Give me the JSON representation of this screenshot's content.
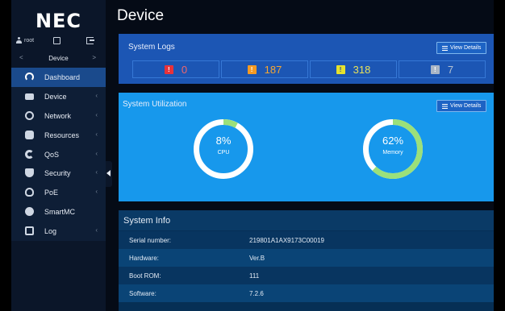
{
  "brand": "NEC",
  "user": {
    "name": "root"
  },
  "breadcrumb": {
    "prev": "<",
    "current": "Device",
    "next": ">"
  },
  "menu": [
    {
      "label": "Dashboard",
      "icon": "dashboard-icon",
      "active": true
    },
    {
      "label": "Device",
      "icon": "device-icon"
    },
    {
      "label": "Network",
      "icon": "network-icon"
    },
    {
      "label": "Resources",
      "icon": "resources-icon"
    },
    {
      "label": "QoS",
      "icon": "qos-icon"
    },
    {
      "label": "Security",
      "icon": "security-icon"
    },
    {
      "label": "PoE",
      "icon": "poe-icon"
    },
    {
      "label": "SmartMC",
      "icon": "smartmc-icon"
    },
    {
      "label": "Log",
      "icon": "log-icon"
    }
  ],
  "page": {
    "title": "Device"
  },
  "system_logs": {
    "title": "System Logs",
    "view_details": "View Details",
    "items": [
      {
        "level": "critical",
        "count": "0",
        "color": "#e8323a",
        "text_color": "#f2666c"
      },
      {
        "level": "major",
        "count": "187",
        "color": "#f59a23",
        "text_color": "#f5a632"
      },
      {
        "level": "minor",
        "count": "318",
        "color": "#e6e22d",
        "text_color": "#e8e25b"
      },
      {
        "level": "warning",
        "count": "7",
        "color": "#a9b6c6",
        "text_color": "#b4c2d2"
      }
    ]
  },
  "system_utilization": {
    "title": "System Utilization",
    "view_details": "View Details",
    "cpu": {
      "value": "8%",
      "label": "CPU",
      "percent": 8
    },
    "memory": {
      "value": "62%",
      "label": "Memory",
      "percent": 62
    }
  },
  "system_info": {
    "title": "System Info",
    "rows": [
      {
        "key": "Serial number:",
        "value": "219801A1AX9173C00019"
      },
      {
        "key": "Hardware:",
        "value": "Ver.B"
      },
      {
        "key": "Boot ROM:",
        "value": "111"
      },
      {
        "key": "Software:",
        "value": "7.2.6"
      }
    ]
  },
  "colors": {
    "logs_panel": "#1c56b4",
    "util_panel": "#1798ec",
    "info_panel": "#062f55",
    "gauge_fill": "#9be07a",
    "gauge_track": "#ffffff"
  }
}
